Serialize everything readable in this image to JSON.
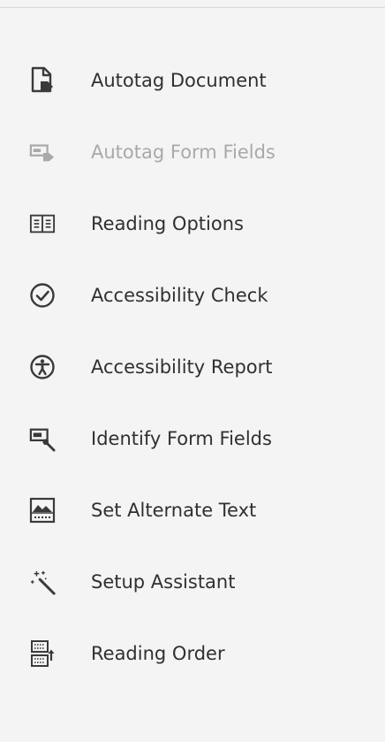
{
  "panel": {
    "tools": [
      {
        "label": "Autotag Document",
        "icon": "autotag-document-icon",
        "enabled": true
      },
      {
        "label": "Autotag Form Fields",
        "icon": "autotag-form-fields-icon",
        "enabled": false
      },
      {
        "label": "Reading Options",
        "icon": "reading-options-icon",
        "enabled": true
      },
      {
        "label": "Accessibility Check",
        "icon": "accessibility-check-icon",
        "enabled": true
      },
      {
        "label": "Accessibility Report",
        "icon": "accessibility-report-icon",
        "enabled": true
      },
      {
        "label": "Identify Form Fields",
        "icon": "identify-form-fields-icon",
        "enabled": true
      },
      {
        "label": "Set Alternate Text",
        "icon": "set-alternate-text-icon",
        "enabled": true
      },
      {
        "label": "Setup Assistant",
        "icon": "setup-assistant-icon",
        "enabled": true
      },
      {
        "label": "Reading Order",
        "icon": "reading-order-icon",
        "enabled": true
      }
    ]
  },
  "colors": {
    "background": "#f4f4f4",
    "text": "#303030",
    "disabled_text": "#a9a9a9",
    "icon": "#3a3a3a",
    "disabled_icon": "#a9a9a9"
  }
}
